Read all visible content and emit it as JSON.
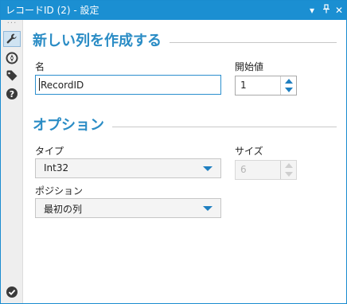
{
  "window": {
    "title": "レコードID (2) - 設定",
    "controls": {
      "menu": "▾",
      "pin": "⊥",
      "close": "✕"
    }
  },
  "sidebar": {
    "items": [
      {
        "icon": "wrench-icon",
        "active": true
      },
      {
        "icon": "compass-icon",
        "active": false
      },
      {
        "icon": "tag-icon",
        "active": false
      },
      {
        "icon": "help-icon",
        "active": false
      }
    ],
    "status_icon": "check-circle-icon"
  },
  "section_new_column": {
    "title": "新しい列を作成する",
    "name_label": "名",
    "name_value": "RecordID",
    "start_label": "開始値",
    "start_value": "1"
  },
  "section_options": {
    "title": "オプション",
    "type_label": "タイプ",
    "type_value": "Int32",
    "size_label": "サイズ",
    "size_value": "6",
    "position_label": "ポジション",
    "position_value": "最初の列"
  },
  "colors": {
    "accent": "#1b8fd2",
    "section_title": "#2a8cc5",
    "dropdown_arrow": "#1f7fc0",
    "icon_dark": "#3a3a3a"
  }
}
